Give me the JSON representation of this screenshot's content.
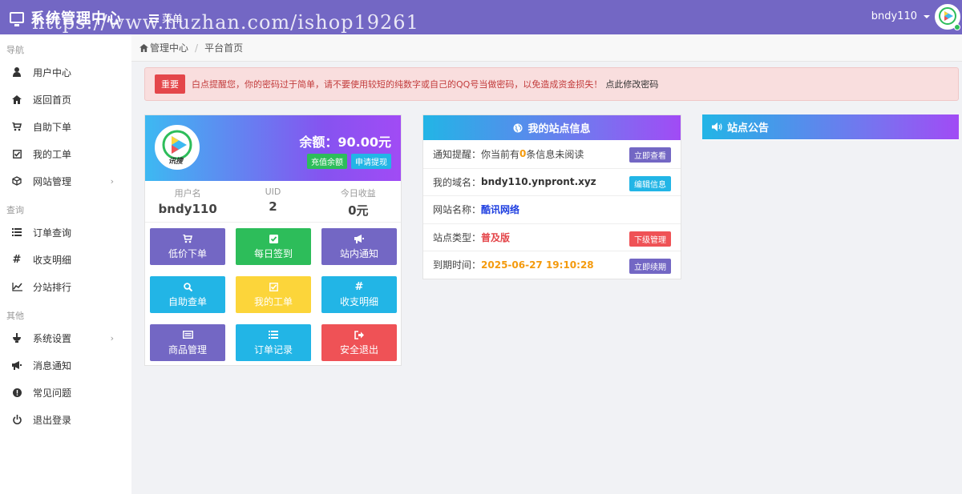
{
  "topbar": {
    "brand_title": "系统管理中心",
    "menu_label": "菜单",
    "watermark": "https://www.huzhan.com/ishop19261",
    "username": "bndy110"
  },
  "sidebar": {
    "sections": [
      {
        "title": "导航",
        "items": [
          {
            "label": "用户中心",
            "icon": "user-icon"
          },
          {
            "label": "返回首页",
            "icon": "home-icon"
          },
          {
            "label": "自助下单",
            "icon": "cart-icon"
          },
          {
            "label": "我的工单",
            "icon": "checkbox-icon"
          },
          {
            "label": "网站管理",
            "icon": "cube-icon",
            "has_children": true
          }
        ]
      },
      {
        "title": "查询",
        "items": [
          {
            "label": "订单查询",
            "icon": "list-icon"
          },
          {
            "label": "收支明细",
            "icon": "hash-icon"
          },
          {
            "label": "分站排行",
            "icon": "chart-line-icon"
          }
        ]
      },
      {
        "title": "其他",
        "items": [
          {
            "label": "系统设置",
            "icon": "settings-icon",
            "has_children": true
          },
          {
            "label": "消息通知",
            "icon": "bullhorn-icon"
          },
          {
            "label": "常见问题",
            "icon": "exclamation-icon"
          },
          {
            "label": "退出登录",
            "icon": "power-icon"
          }
        ]
      }
    ],
    "chevron": "›"
  },
  "breadcrumb": {
    "home": "管理中心",
    "separator": "/",
    "current": "平台首页"
  },
  "alert": {
    "badge": "重要",
    "text": "白点提醒您，你的密码过于简单，请不要使用较短的纯数字或自己的QQ号当做密码，以免造成资金损失！",
    "link": "点此修改密码"
  },
  "user_card": {
    "logo_text": "讯搜",
    "balance": "余额：90.00元",
    "recharge_label": "充值余额",
    "withdraw_label": "申请提现",
    "stats": [
      {
        "label": "用户名",
        "value": "bndy110"
      },
      {
        "label": "UID",
        "value": "2"
      },
      {
        "label": "今日收益",
        "value": "0元"
      }
    ],
    "tiles": [
      {
        "label": "低价下单",
        "icon": "cart-icon",
        "color": "#7367c4"
      },
      {
        "label": "每日签到",
        "icon": "check-square-icon",
        "color": "#2dbd5a"
      },
      {
        "label": "站内通知",
        "icon": "bullhorn-icon",
        "color": "#7367c4"
      },
      {
        "label": "自助查单",
        "icon": "search-icon",
        "color": "#22b5e6"
      },
      {
        "label": "我的工单",
        "icon": "checkbox-icon",
        "color": "#fcd53a"
      },
      {
        "label": "收支明细",
        "icon": "hash-icon",
        "color": "#22b5e6"
      },
      {
        "label": "商品管理",
        "icon": "card-icon",
        "color": "#7367c4"
      },
      {
        "label": "订单记录",
        "icon": "list-icon",
        "color": "#22b5e6"
      },
      {
        "label": "安全退出",
        "icon": "sign-out-icon",
        "color": "#ef5256"
      }
    ]
  },
  "site_info": {
    "title": "我的站点信息",
    "notice_prefix": "通知提醒：你当前有",
    "notice_count": "0",
    "notice_suffix": "条信息未阅读",
    "notice_btn": "立即查看",
    "domain_label": "我的域名：",
    "domain_value": "bndy110.ynpront.xyz",
    "domain_btn": "编辑信息",
    "name_label": "网站名称：",
    "name_value": "酷讯网络",
    "type_label": "站点类型：",
    "type_value": "普及版",
    "type_btn": "下级管理",
    "expire_label": "到期时间：",
    "expire_value": "2025-06-27 19:10:28",
    "expire_btn": "立即续期"
  },
  "announcement": {
    "title": "站点公告"
  },
  "colors": {
    "topbar": "#7367c4",
    "purple": "#7367c4",
    "green": "#2dbd5a",
    "cyan": "#22b5e6",
    "yellow": "#fcd53a",
    "red": "#ef5256",
    "orange": "#f49a0d",
    "blue_text": "#1f3fe0"
  }
}
